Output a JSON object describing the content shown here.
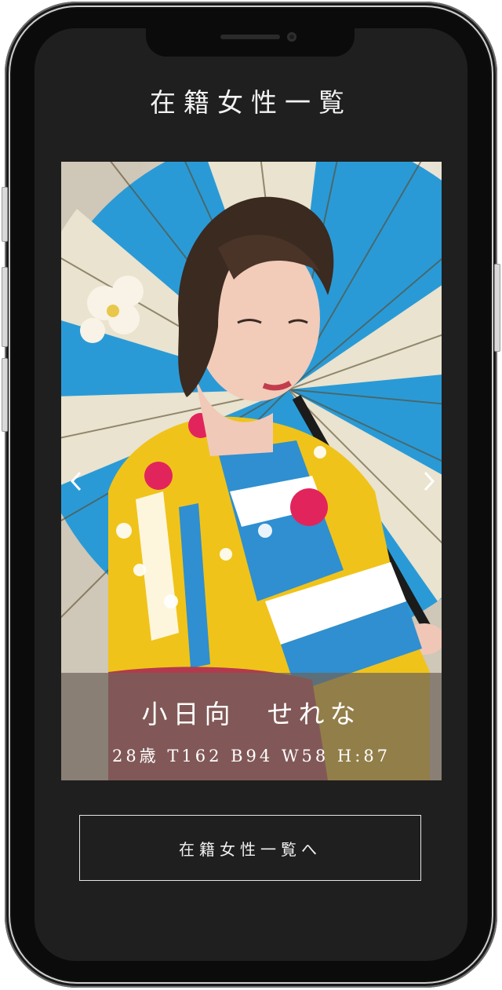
{
  "header": {
    "title": "在籍女性一覧"
  },
  "slider": {
    "current_profile": {
      "name": "小日向　せれな",
      "stats": "28歳 T162 B94 W58 H:87"
    }
  },
  "footer": {
    "list_button_label": "在籍女性一覧へ"
  },
  "colors": {
    "screen_background": "#1f1f1f",
    "caption_overlay": "#6e645c",
    "text": "#ffffff"
  },
  "icons": [
    "chevron-left-icon",
    "chevron-right-icon"
  ]
}
